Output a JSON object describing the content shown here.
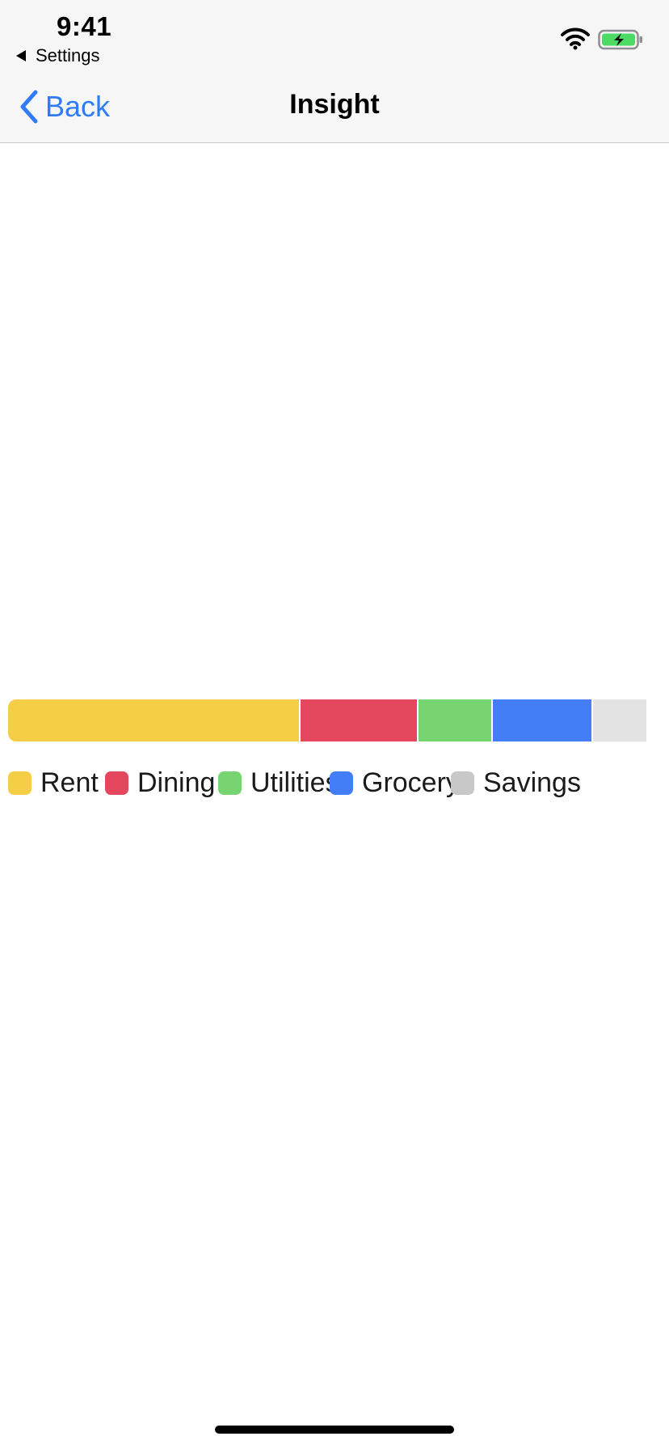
{
  "status_bar": {
    "time": "9:41",
    "back_app": "Settings",
    "wifi_icon": "wifi-icon",
    "battery_icon": "battery-charging-icon",
    "battery_color": "#4cd964"
  },
  "nav_bar": {
    "back_label": "Back",
    "title": "Insight",
    "accent_color": "#2f7cf6"
  },
  "chart_data": {
    "type": "bar",
    "orientation": "horizontal-stacked",
    "legend_placement": "below",
    "series": [
      {
        "name": "Rent",
        "value": 46,
        "color": "#f5cd46"
      },
      {
        "name": "Dining",
        "value": 18.5,
        "color": "#e4475e"
      },
      {
        "name": "Utilities",
        "value": 11.5,
        "color": "#77d470"
      },
      {
        "name": "Grocery",
        "value": 15.5,
        "color": "#437ef6"
      },
      {
        "name": "Savings",
        "value": 8.5,
        "color": "#e3e3e3"
      }
    ]
  }
}
